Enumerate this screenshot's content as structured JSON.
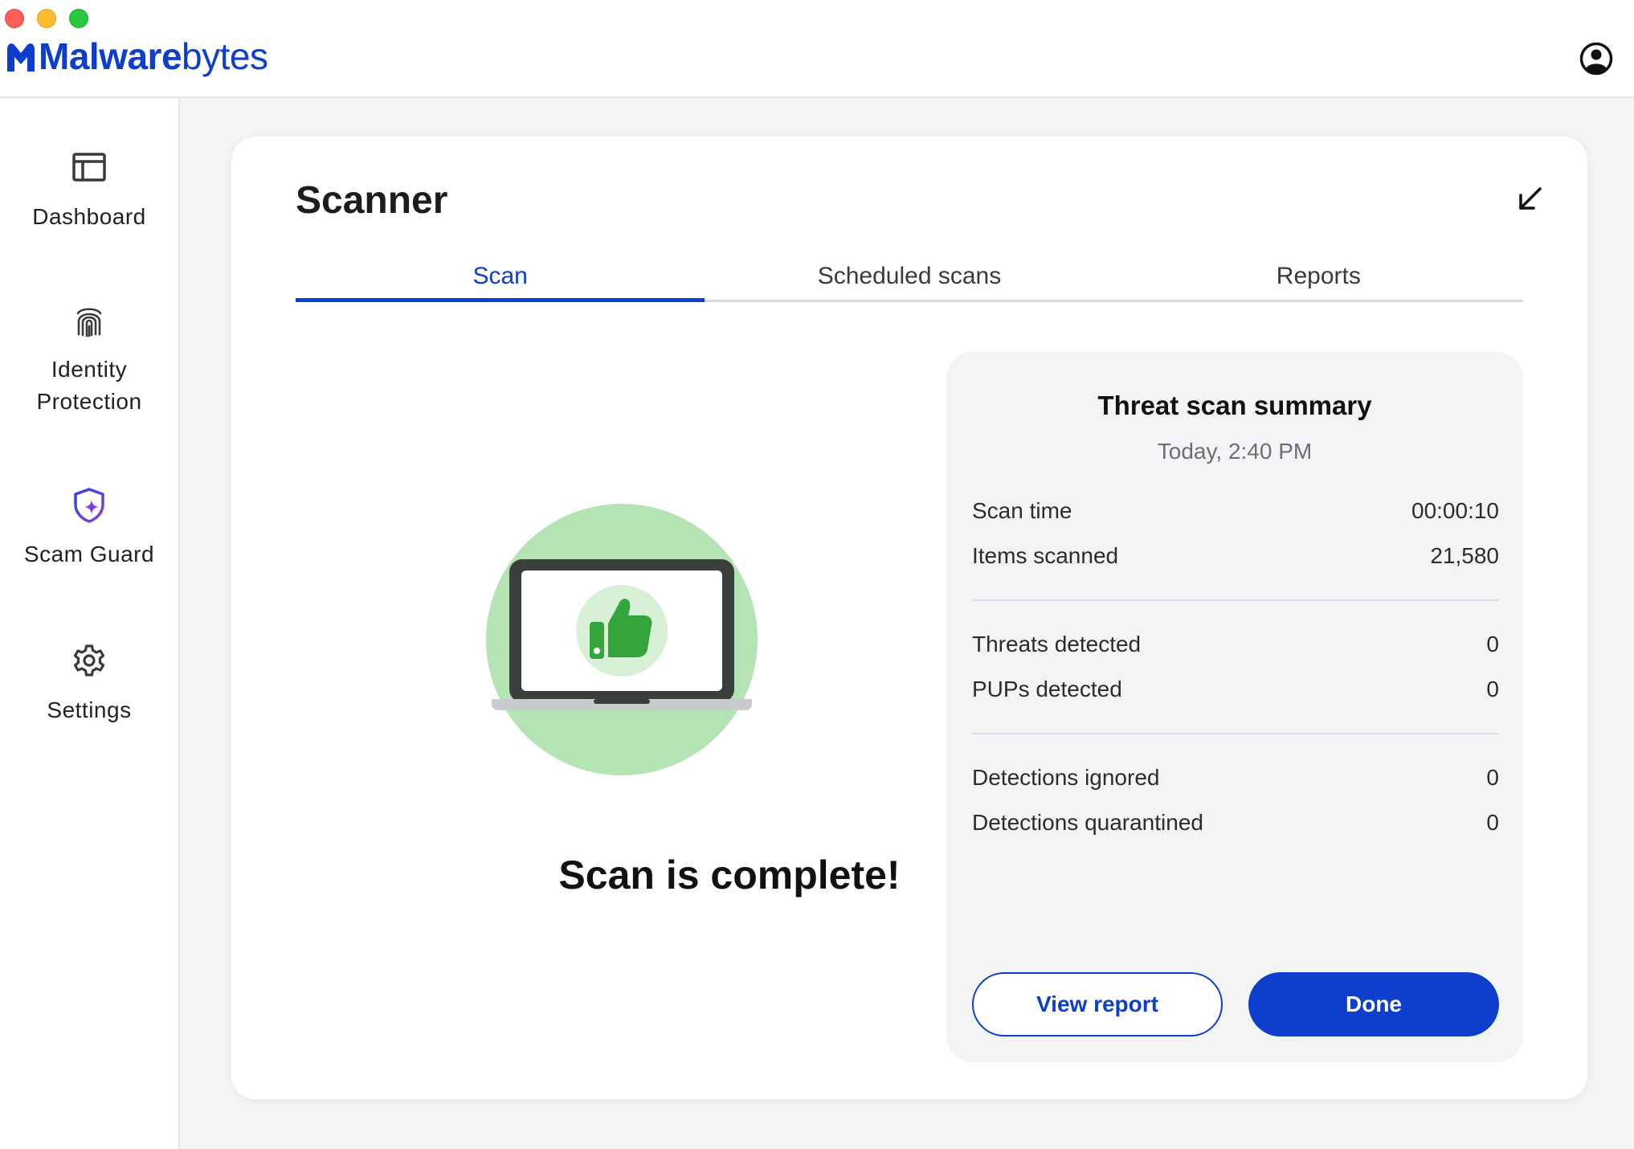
{
  "app": {
    "logo_bold": "Malware",
    "logo_regular": "bytes"
  },
  "sidebar": {
    "items": [
      {
        "label": "Dashboard",
        "icon": "dashboard-icon"
      },
      {
        "label": "Identity\nProtection",
        "icon": "fingerprint-icon"
      },
      {
        "label": "Scam Guard",
        "icon": "shield-sparkle-icon"
      },
      {
        "label": "Settings",
        "icon": "gear-icon"
      }
    ]
  },
  "scanner": {
    "title": "Scanner",
    "tabs": [
      {
        "label": "Scan",
        "active": true
      },
      {
        "label": "Scheduled scans",
        "active": false
      },
      {
        "label": "Reports",
        "active": false
      }
    ],
    "complete_message": "Scan is complete!"
  },
  "summary": {
    "title": "Threat scan summary",
    "date": "Today, 2:40 PM",
    "groups": [
      [
        {
          "label": "Scan time",
          "value": "00:00:10"
        },
        {
          "label": "Items scanned",
          "value": "21,580"
        }
      ],
      [
        {
          "label": "Threats detected",
          "value": "0"
        },
        {
          "label": "PUPs detected",
          "value": "0"
        }
      ],
      [
        {
          "label": "Detections ignored",
          "value": "0"
        },
        {
          "label": "Detections quarantined",
          "value": "0"
        }
      ]
    ],
    "view_report_label": "View report",
    "done_label": "Done"
  },
  "colors": {
    "accent": "#0d3ecc",
    "success_circle": "#b5e4b4",
    "thumb_green": "#34a43c"
  }
}
